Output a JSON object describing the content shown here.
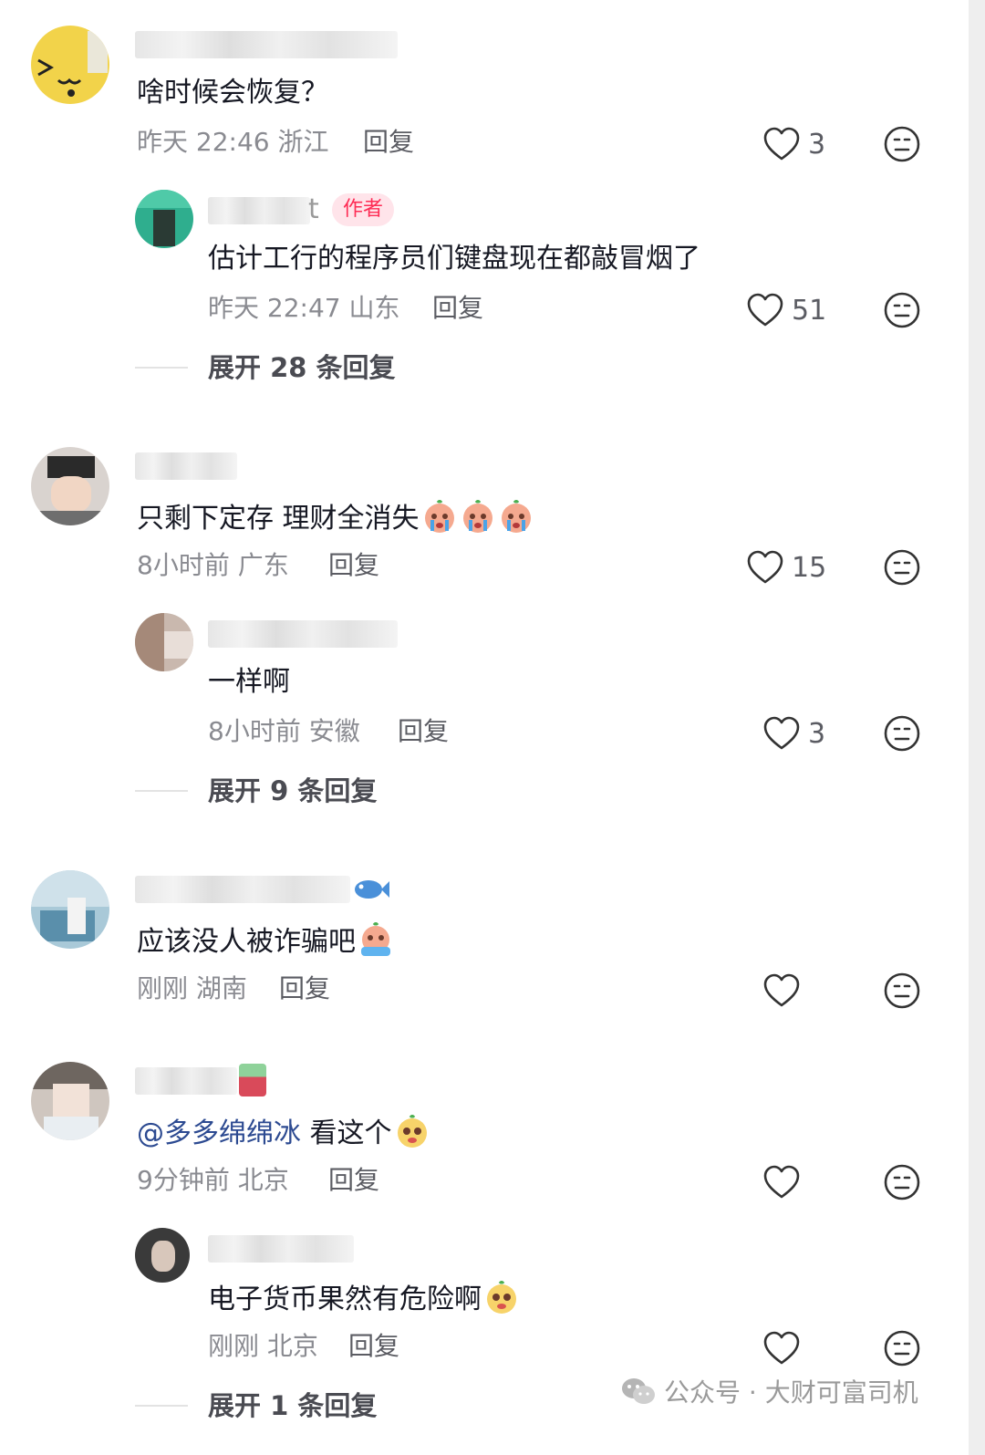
{
  "comments": [
    {
      "text": "啥时候会恢复？",
      "meta": "昨天 22:46 浙江",
      "reply_label": "回复",
      "likes": "3",
      "reply": {
        "author_badge": "作者",
        "name_tail": "t",
        "text": "估计工行的程序员们键盘现在都敲冒烟了",
        "meta": "昨天 22:47 山东",
        "reply_label": "回复",
        "likes": "51"
      },
      "expand_label": "展开 28 条回复"
    },
    {
      "text": "只剩下定存 理财全消失",
      "meta": "8小时前 广东",
      "reply_label": "回复",
      "likes": "15",
      "reply": {
        "text": "一样啊",
        "meta": "8小时前 安徽",
        "reply_label": "回复",
        "likes": "3"
      },
      "expand_label": "展开 9 条回复"
    },
    {
      "text": "应该没人被诈骗吧",
      "meta": "刚刚 湖南",
      "reply_label": "回复",
      "likes": ""
    },
    {
      "mention": "@多多绵绵冰",
      "text": "看这个",
      "meta": "9分钟前 北京",
      "reply_label": "回复",
      "likes": "",
      "reply": {
        "text": "电子货币果然有危险啊",
        "meta": "刚刚 北京",
        "reply_label": "回复",
        "likes": ""
      },
      "expand_label": "展开 1 条回复"
    }
  ],
  "watermark": {
    "text": "公众号 · 大财可富司机",
    "icon": "wechat-icon"
  },
  "colors": {
    "author_badge": "#fe2c55",
    "mention": "#2c4a91",
    "meta": "#8a8b91"
  }
}
